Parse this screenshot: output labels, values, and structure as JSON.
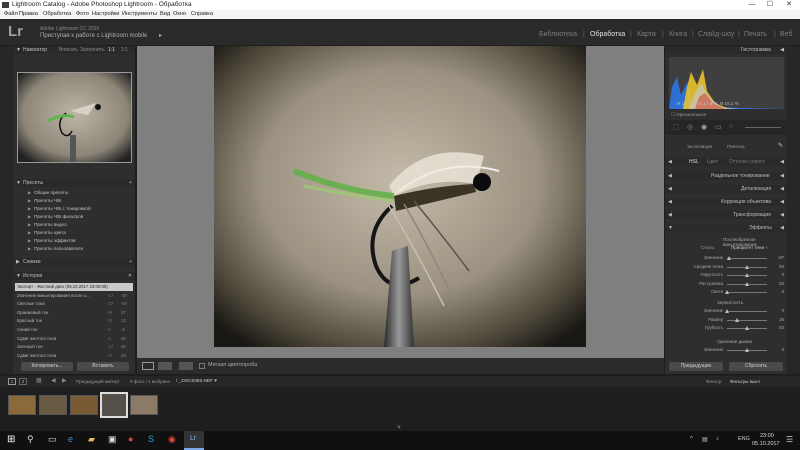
{
  "window": {
    "title": "Lightroom Catalog - Adobe Photoshop Lightroom - Обработка",
    "controls": [
      "—",
      "☐",
      "✕"
    ]
  },
  "menu": [
    "Файл",
    "Правка",
    "Обработка",
    "Фото",
    "Настройки",
    "Инструменты",
    "Вид",
    "Окно",
    "Справка"
  ],
  "header": {
    "logo": "Lr",
    "product": "Adobe Lightroom CC 2015",
    "subtitle": "Приступая к работе с Lightroom mobile",
    "arrow": "▸",
    "modules": [
      "Библиотека",
      "Обработка",
      "Карта",
      "Книга",
      "Слайд-шоу",
      "Печать",
      "Веб"
    ],
    "active_module": "Обработка"
  },
  "left_panel": {
    "navigator": {
      "title": "Навигатор",
      "options": [
        "Вписать",
        "Заполнить",
        "1:1",
        "2:1"
      ]
    },
    "presets": {
      "title": "Пресеты",
      "items": [
        "Общие пресеты",
        "Пресеты Ч/Б",
        "Пресеты Ч/Б с тонировкой",
        "Пресеты Ч/Б фильтров",
        "Пресеты видео",
        "Пресеты цвета",
        "Пресеты эффектов",
        "Пресеты пользователя"
      ]
    },
    "snapshots": {
      "title": "Снимки"
    },
    "history": {
      "title": "История",
      "items": [
        {
          "label": "Экспорт - Жесткий диск (05.10.2017 23:00:00)",
          "a": "",
          "b": ""
        },
        {
          "label": "Значение виньетирования после о...",
          "a": "-17",
          "b": "-97"
        },
        {
          "label": "Светлые тона",
          "a": "-37",
          "b": "-57"
        },
        {
          "label": "Оранжевый тон",
          "a": "+8",
          "b": "27"
        },
        {
          "label": "Красный тон",
          "a": "+3",
          "b": "13"
        },
        {
          "label": "Синий тон",
          "a": "-4",
          "b": "-4"
        },
        {
          "label": "Сдвиг желтого тона",
          "a": "-4",
          "b": "26"
        },
        {
          "label": "Зеленый тон",
          "a": "-17",
          "b": "26"
        },
        {
          "label": "Сдвиг желтого тона",
          "a": "+3",
          "b": "43"
        }
      ]
    },
    "buttons": {
      "copy": "Копировать...",
      "paste": "Вставить"
    }
  },
  "right_panel": {
    "histogram": {
      "title": "Гистограмма",
      "readout": {
        "R": "19,1",
        "G": "17,8",
        "B": "15,1",
        "unit": "%"
      },
      "original_label": "Оригинальное"
    },
    "basic_header": {
      "left": "Экспозиция",
      "right": "Пипетка"
    },
    "hsl": {
      "tabs": [
        "HSL",
        "Цвет",
        "Оттенки серого"
      ]
    },
    "sections": [
      "Раздельное тонирование",
      "Детализация",
      "Коррекция объектива",
      "Трансформация",
      "Эффекты"
    ],
    "effects": {
      "vignette_title": "Послеобрезное виньетирование",
      "style_label": "Стиль:",
      "style_value": "Приоритет тени ÷",
      "sliders": [
        {
          "label": "Значение",
          "value": "-97",
          "pos": 0.06
        },
        {
          "label": "Средняя точка",
          "value": "50",
          "pos": 0.5
        },
        {
          "label": "Округлость",
          "value": "0",
          "pos": 0.5
        },
        {
          "label": "Растушевка",
          "value": "50",
          "pos": 0.5
        },
        {
          "label": "Свети",
          "value": "0",
          "pos": 0.0
        }
      ],
      "grain_title": "Зернистость",
      "grain_sliders": [
        {
          "label": "Значение",
          "value": "0",
          "pos": 0.0
        },
        {
          "label": "Размер",
          "value": "25",
          "pos": 0.25
        },
        {
          "label": "Грубость",
          "value": "50",
          "pos": 0.5
        }
      ],
      "dehaze_title": "Удаление дымки",
      "dehaze_slider": {
        "label": "Значение",
        "value": "0",
        "pos": 0.5
      }
    },
    "buttons": {
      "previous": "Предыдущие",
      "reset": "Сбросить"
    }
  },
  "toolbar": {
    "softproof_label": "Мягкая цветопроба"
  },
  "filmstrip_bar": {
    "page1": "1",
    "page2": "2",
    "source": "Предыдущий импорт",
    "count": "5 фото / 1 выбрано",
    "file": "/ _DSC6365.NEF ▾",
    "filter_label": "Фильтр:",
    "filter_value": "Фильтры выкл"
  },
  "filmstrip": {
    "thumb_count": 5,
    "selected_index": 3
  },
  "taskbar": {
    "lang": "ENG",
    "time": "23:00",
    "date": "05.10.2017"
  },
  "colors": {
    "panel_bg": "#2e2e2e",
    "center_bg": "#7f7f7f",
    "active_module": "#e0e0e0",
    "histogram_blue": "#2f6fd6",
    "histogram_yellow": "#e8c22a"
  }
}
